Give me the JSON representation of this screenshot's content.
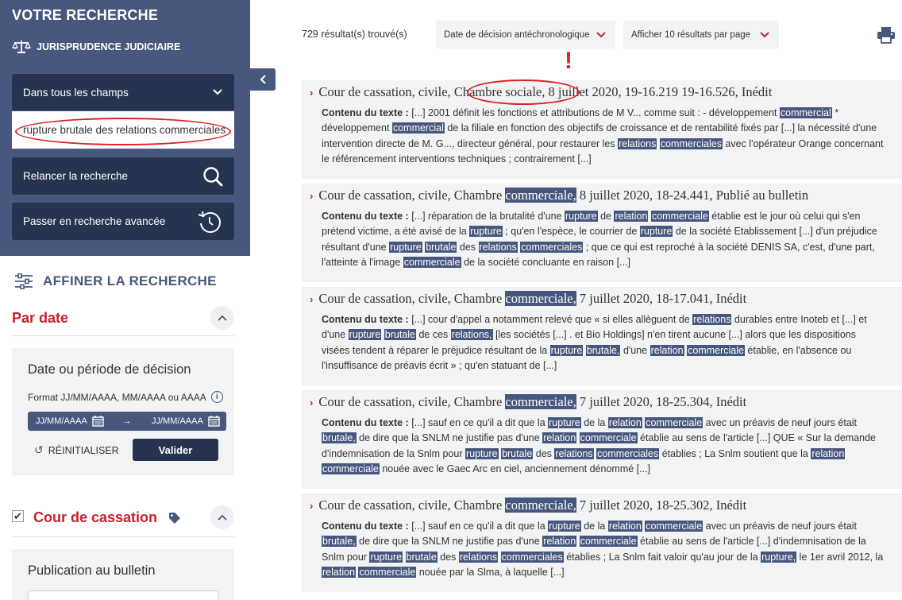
{
  "sidebar": {
    "title": "VOTRE RECHERCHE",
    "jurisdiction_label": "JURISPRUDENCE JUDICIAIRE",
    "field_select_value": "Dans tous les champs",
    "search_value": "rupture brutale des relations commerciales",
    "relaunch_label": "Relancer la recherche",
    "advanced_label": "Passer en recherche avancée",
    "refine_title": "AFFINER LA RECHERCHE",
    "date_section": {
      "heading": "Par date",
      "box_title": "Date ou période de décision",
      "format_hint": "Format JJ/MM/AAAA, MM/AAAA ou AAAA",
      "from_placeholder": "JJ/MM/AAAA",
      "to_placeholder": "JJ/MM/AAAA",
      "reset_label": "RÉINITIALISER",
      "validate_label": "Valider"
    },
    "court_section": {
      "heading": "Cour de cassation",
      "checked": true,
      "publication_title": "Publication au bulletin"
    }
  },
  "main": {
    "results_count": "729 résultat(s) trouvé(s)",
    "sort_value": "Date de décision antéchronologique",
    "per_page_value": "Afficher 10 résultats par page",
    "annotation_mark": "!",
    "results": [
      {
        "title_prefix": "Cour de cassation, civile, ",
        "title_chamber": "Chambre sociale,",
        "title_suffix": " 8 juillet 2020, 19-16.219 19-16.526, Inédit",
        "label": "Contenu du texte :",
        "body_html": "[...] 2001 définit les fonctions et attributions de M V... comme suit : - développement <span class=\"hl\">commercial</span> * développement <span class=\"hl\">commercial</span> de la filiale en fonction des objectifs de croissance et de rentabilité fixés par [...] la nécessité d'une intervention directe de M. G..., directeur général, pour restaurer les <span class=\"hl\">relations</span> <span class=\"hl\">commerciales</span> avec l'opérateur Orange concernant le référencement interventions techniques ; contrairement [...]"
      },
      {
        "title_prefix": "Cour de cassation, civile, Chambre ",
        "title_chamber": "commerciale,",
        "title_suffix": " 8 juillet 2020, 18-24.441, Publié au bulletin",
        "label": "Contenu du texte :",
        "body_html": "[...] réparation de la brutalité d'une <span class=\"hl\">rupture</span> de <span class=\"hl\">relation</span> <span class=\"hl\">commerciale</span> établie est le jour où celui qui s'en prétend victime, a été avisé de la <span class=\"hl\">rupture</span> ; qu'en l'espèce, le courrier de <span class=\"hl\">rupture</span> de la société Etablissement [...] d'un préjudice résultant d'une <span class=\"hl\">rupture</span> <span class=\"hl\">brutale</span> des <span class=\"hl\">relations</span> <span class=\"hl\">commerciales</span> ; que ce qui est reproché à la société DENIS SA, c'est, d'une part, l'atteinte à l'image <span class=\"hl\">commerciale</span> de la société concluante en raison [...]"
      },
      {
        "title_prefix": "Cour de cassation, civile, Chambre ",
        "title_chamber": "commerciale,",
        "title_suffix": " 7 juillet 2020, 18-17.041, Inédit",
        "label": "Contenu du texte :",
        "body_html": "[...] cour d'appel a notamment relevé que « si elles allèguent de <span class=\"hl\">relations</span> durables entre Inoteb et [...] et d'une <span class=\"hl\">rupture</span> <span class=\"hl\">brutale</span> de ces <span class=\"hl\">relations,</span> [les sociétés [...] . et Bio Holdings] n'en tirent aucune [...] alors que les dispositions visées tendent à réparer le préjudice résultant de la <span class=\"hl\">rupture</span> <span class=\"hl\">brutale,</span> d'une <span class=\"hl\">relation</span> <span class=\"hl\">commerciale</span> établie, en l'absence ou l'insuffisance de préavis écrit » ; qu'en statuant de [...]"
      },
      {
        "title_prefix": "Cour de cassation, civile, Chambre ",
        "title_chamber": "commerciale,",
        "title_suffix": " 7 juillet 2020, 18-25.304, Inédit",
        "label": "Contenu du texte :",
        "body_html": "[...] sauf en ce qu'il a dit que la <span class=\"hl\">rupture</span> de la <span class=\"hl\">relation</span> <span class=\"hl\">commerciale</span> avec un préavis de neuf jours était <span class=\"hl\">brutale,</span> de dire que la SNLM ne justifie pas d'une <span class=\"hl\">relation</span> <span class=\"hl\">commerciale</span> établie au sens de l'article [...] QUE « Sur la demande d'indemnisation de la Snlm pour <span class=\"hl\">rupture</span> <span class=\"hl\">brutale</span> des <span class=\"hl\">relations</span> <span class=\"hl\">commerciales</span> établies ; La Snlm soutient que la <span class=\"hl\">relation</span> <span class=\"hl\">commerciale</span> nouée avec le Gaec Arc en ciel, anciennement dénommé [...]"
      },
      {
        "title_prefix": "Cour de cassation, civile, Chambre ",
        "title_chamber": "commerciale,",
        "title_suffix": " 7 juillet 2020, 18-25.302, Inédit",
        "label": "Contenu du texte :",
        "body_html": "[...] sauf en ce qu'il a dit que la <span class=\"hl\">rupture</span> de la <span class=\"hl\">relation</span> <span class=\"hl\">commerciale</span> avec un préavis de neuf jours était <span class=\"hl\">brutale,</span> de dire que la SNLM ne justifie pas d'une <span class=\"hl\">relation</span> <span class=\"hl\">commerciale</span> établie au sens de l'article [...] d'indemnisation de la Snlm pour <span class=\"hl\">rupture</span> <span class=\"hl\">brutale</span> des <span class=\"hl\">relations</span> <span class=\"hl\">commerciales</span> établies ; La Snlm fait valoir qu'au jour de la <span class=\"hl\">rupture,</span> le 1er avril 2012, la <span class=\"hl\">relation</span> <span class=\"hl\">commerciale</span> nouée par la Slma, à laquelle [...]"
      }
    ]
  },
  "colors": {
    "panel": "#47577d",
    "button_dark": "#26344f",
    "accent_red": "#c7212a",
    "light_bg": "#f2f3f5"
  },
  "icons": {
    "jurisdiction": "scales-icon",
    "field_select": "chevron-down-icon",
    "relaunch": "search-icon",
    "advanced": "refresh-icon",
    "collapse": "chevron-left-icon",
    "refine": "sliders-icon",
    "print": "printer-icon"
  }
}
